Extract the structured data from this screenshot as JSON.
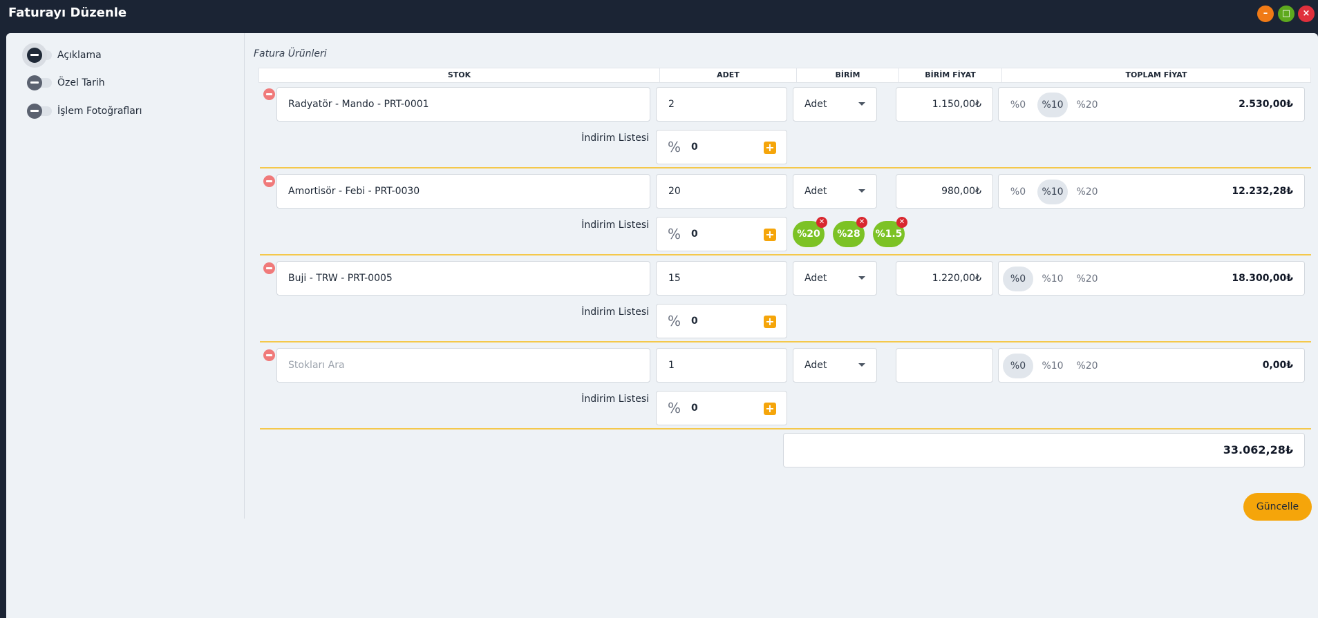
{
  "window": {
    "title": "Faturayı Düzenle"
  },
  "sidebar": {
    "options": [
      {
        "label": "Açıklama"
      },
      {
        "label": "Özel Tarih"
      },
      {
        "label": "İşlem Fotoğrafları"
      }
    ]
  },
  "section_title": "Fatura Ürünleri",
  "table": {
    "headers": [
      "STOK",
      "ADET",
      "BİRİM",
      "BİRİM FİYAT",
      "TOPLAM FİYAT"
    ],
    "vat_options": [
      "%0",
      "%10",
      "%20"
    ],
    "discount_label": "İndirim Listesi",
    "rows": [
      {
        "stock": "Radyatör - Mando - PRT-0001",
        "qty": "2",
        "unit": "Adet",
        "unit_price": "1.150,00₺",
        "vat_selected": "%10",
        "total": "2.530,00₺",
        "discount": "0",
        "chips": []
      },
      {
        "stock": "Amortisör - Febi - PRT-0030",
        "qty": "20",
        "unit": "Adet",
        "unit_price": "980,00₺",
        "vat_selected": "%10",
        "total": "12.232,28₺",
        "discount": "0",
        "chips": [
          "%20",
          "%28",
          "%1.5"
        ]
      },
      {
        "stock": "Buji - TRW - PRT-0005",
        "qty": "15",
        "unit": "Adet",
        "unit_price": "1.220,00₺",
        "vat_selected": "%0",
        "total": "18.300,00₺",
        "discount": "0",
        "chips": []
      },
      {
        "stock": "",
        "stock_placeholder": "Stokları Ara",
        "qty": "1",
        "unit": "Adet",
        "unit_price": "",
        "vat_selected": "%0",
        "total": "0,00₺",
        "discount": "0",
        "chips": []
      }
    ]
  },
  "grand_total": "33.062,28₺",
  "buttons": {
    "update": "Güncelle"
  },
  "colors": {
    "accent": "#f5a50a",
    "chip": "#7cc225",
    "title_bar": "#1b2434"
  }
}
